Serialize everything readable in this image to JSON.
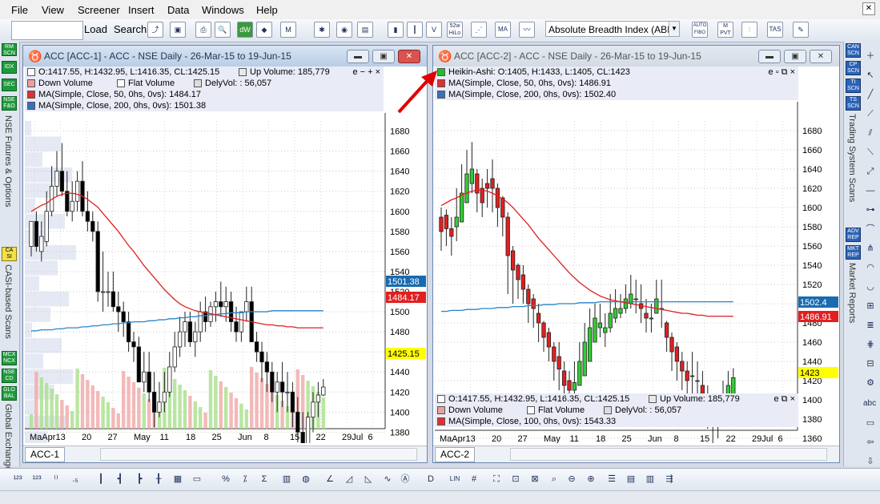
{
  "menu": [
    "File",
    "View",
    "Screener",
    "Insert",
    "Data",
    "Windows",
    "Help"
  ],
  "toolbar": {
    "symbol_value": "",
    "load_label": "Load",
    "search_label": "Search",
    "indicator_select": "Absolute Breadth Index (ABI",
    "icon_52w": "52w\nHiLo",
    "icon_ma": "MA",
    "icon_autofibo": "AUTO\nFIBO",
    "icon_pvt": "M\nPVT",
    "icon_tas": "TAS"
  },
  "left_sidebar": {
    "buttons": [
      "RM\nSCN",
      "IDX",
      "SEC",
      "NSE\nF&O",
      "CA\nSI",
      "MCX\nNCX",
      "NSE\nCD",
      "GLO\nBAL"
    ],
    "labels": [
      "NSE Futures & Options",
      "CASI-based Scans",
      "Global Exchange"
    ]
  },
  "right_sidebar": {
    "buttons": [
      "CAN\nSCN",
      "CP\nSCN",
      "TI\nSCN",
      "TS\nSCN",
      "ADV\nREP",
      "MKT\nREP"
    ],
    "labels": [
      "Trading System Scans",
      "Market Reports"
    ],
    "abc_label": "abc"
  },
  "charts": [
    {
      "title": "ACC [ACC-1] - ACC - NSE Daily - 26-Mar-15 to 19-Jun-15",
      "tab": "ACC-1",
      "legend": [
        {
          "c1": "O:1417.55, H:1432.95, L:1416.35, CL:1425.15",
          "c2": "Up Volume: 185,779",
          "color": "#e8e8e8"
        },
        {
          "c1": "Down Volume",
          "c2": "Flat Volume",
          "c3": "DelyVol: : 56,057",
          "color": "#e8a0a0"
        },
        {
          "c1": "MA(Simple, Close, 50, 0hs, 0vs): 1484.17",
          "color": "#e03030"
        },
        {
          "c1": "MA(Simple, Close, 200, 0hs, 0vs): 1501.38",
          "color": "#3a6fc0"
        }
      ],
      "legend_ctrl": "e − + ×",
      "y_ticks": [
        "1680",
        "1660",
        "1640",
        "1620",
        "1600",
        "1580",
        "1560",
        "1540",
        "1520",
        "1500",
        "1480",
        "1460",
        "1440",
        "1420",
        "1400",
        "1380",
        "1360"
      ],
      "x_ticks": [
        "MaApr",
        "13",
        "20",
        "27",
        "May",
        "11",
        "18",
        "25",
        "Jun",
        "8",
        "15",
        "22",
        "29Jul",
        "6"
      ],
      "tags": [
        {
          "text": "1501.38",
          "bg": "#1a6ab0",
          "fg": "#ffffff"
        },
        {
          "text": "1484.17",
          "bg": "#e02020",
          "fg": "#ffffff"
        },
        {
          "text": "1425.15",
          "bg": "#ffff00",
          "fg": "#000000"
        }
      ]
    },
    {
      "title": "ACC [ACC-2] - ACC - NSE Daily - 26-Mar-15 to 19-Jun-15",
      "tab": "ACC-2",
      "legend": [
        {
          "c1": "Heikin-Ashi: O:1405, H:1433, L:1405, CL:1423",
          "color": "#20c020"
        },
        {
          "c1": "MA(Simple, Close, 50, 0hs, 0vs): 1486.91",
          "color": "#e03030"
        },
        {
          "c1": "MA(Simple, Close, 200, 0hs, 0vs): 1502.40",
          "color": "#3a6fc0"
        }
      ],
      "legend_ctrl": "e ▫ ⧉ ×",
      "vol_legend": [
        {
          "c1": "O:1417.55, H:1432.95, L:1416.35, CL:1425.15",
          "c2": "Up Volume: 185,779",
          "color": "#e8e8e8"
        },
        {
          "c1": "Down Volume",
          "c2": "Flat Volume",
          "c3": "DelyVol: : 56,057",
          "color": "#e8a0a0"
        },
        {
          "c1": "MA(Simple, Close, 100, 0hs, 0vs): 1543.33",
          "color": "#e03030"
        }
      ],
      "vol_legend_ctrl": "e ⧉ ×",
      "y_ticks": [
        "1680",
        "1660",
        "1640",
        "1620",
        "1600",
        "1580",
        "1560",
        "1540",
        "1520",
        "1500",
        "1480",
        "1460",
        "1440",
        "1420",
        "1400",
        "1380",
        "1360"
      ],
      "x_ticks": [
        "MaApr",
        "13",
        "20",
        "27",
        "May",
        "11",
        "18",
        "25",
        "Jun",
        "8",
        "15",
        "22",
        "29Jul",
        "6"
      ],
      "tags": [
        {
          "text": "1502.4",
          "bg": "#1a6ab0",
          "fg": "#ffffff"
        },
        {
          "text": "1486.91",
          "bg": "#e02020",
          "fg": "#ffffff"
        },
        {
          "text": "1423",
          "bg": "#ffff00",
          "fg": "#000000"
        },
        {
          "text": "1425.15",
          "bg": "#ffff00",
          "fg": "#000000"
        }
      ]
    }
  ],
  "chart_data": [
    {
      "type": "candlestick",
      "title": "ACC - NSE Daily - 26-Mar-15 to 19-Jun-15",
      "ylim": [
        1350,
        1690
      ],
      "x": [
        "26-Mar",
        "27-Mar",
        "30-Mar",
        "31-Mar",
        "1-Apr",
        "6-Apr",
        "7-Apr",
        "8-Apr",
        "9-Apr",
        "10-Apr",
        "13-Apr",
        "15-Apr",
        "16-Apr",
        "17-Apr",
        "20-Apr",
        "21-Apr",
        "22-Apr",
        "23-Apr",
        "24-Apr",
        "27-Apr",
        "28-Apr",
        "29-Apr",
        "30-Apr",
        "4-May",
        "5-May",
        "6-May",
        "7-May",
        "8-May",
        "11-May",
        "12-May",
        "13-May",
        "14-May",
        "15-May",
        "18-May",
        "19-May",
        "20-May",
        "21-May",
        "22-May",
        "25-May",
        "26-May",
        "27-May",
        "28-May",
        "29-May",
        "1-Jun",
        "2-Jun",
        "3-Jun",
        "4-Jun",
        "5-Jun",
        "8-Jun",
        "9-Jun",
        "10-Jun",
        "11-Jun",
        "12-Jun",
        "15-Jun",
        "16-Jun",
        "17-Jun",
        "18-Jun",
        "19-Jun"
      ],
      "open": [
        1565,
        1590,
        1560,
        1570,
        1600,
        1625,
        1640,
        1620,
        1600,
        1610,
        1630,
        1600,
        1590,
        1580,
        1520,
        1520,
        1520,
        1505,
        1500,
        1490,
        1470,
        1465,
        1430,
        1440,
        1420,
        1400,
        1410,
        1420,
        1445,
        1465,
        1480,
        1490,
        1470,
        1480,
        1500,
        1490,
        1505,
        1510,
        1505,
        1510,
        1490,
        1480,
        1500,
        1510,
        1470,
        1460,
        1450,
        1440,
        1420,
        1430,
        1420,
        1420,
        1400,
        1380,
        1365,
        1395,
        1410,
        1417
      ],
      "high": [
        1590,
        1600,
        1590,
        1620,
        1645,
        1660,
        1668,
        1640,
        1630,
        1640,
        1650,
        1620,
        1600,
        1590,
        1560,
        1540,
        1540,
        1520,
        1510,
        1500,
        1480,
        1475,
        1460,
        1460,
        1440,
        1430,
        1440,
        1460,
        1480,
        1495,
        1500,
        1500,
        1490,
        1510,
        1515,
        1510,
        1520,
        1530,
        1525,
        1520,
        1505,
        1500,
        1525,
        1525,
        1480,
        1470,
        1460,
        1450,
        1440,
        1450,
        1440,
        1430,
        1415,
        1400,
        1400,
        1420,
        1430,
        1433
      ],
      "low": [
        1555,
        1560,
        1550,
        1565,
        1595,
        1615,
        1615,
        1595,
        1590,
        1600,
        1595,
        1580,
        1570,
        1510,
        1500,
        1505,
        1500,
        1480,
        1475,
        1460,
        1450,
        1440,
        1420,
        1410,
        1385,
        1395,
        1400,
        1415,
        1440,
        1455,
        1465,
        1465,
        1455,
        1470,
        1480,
        1485,
        1490,
        1495,
        1490,
        1480,
        1470,
        1470,
        1490,
        1475,
        1450,
        1430,
        1420,
        1410,
        1400,
        1405,
        1400,
        1385,
        1370,
        1355,
        1360,
        1380,
        1395,
        1416
      ],
      "close": [
        1590,
        1565,
        1575,
        1600,
        1625,
        1640,
        1620,
        1600,
        1610,
        1630,
        1600,
        1590,
        1580,
        1520,
        1520,
        1520,
        1505,
        1500,
        1490,
        1470,
        1465,
        1430,
        1440,
        1420,
        1400,
        1410,
        1420,
        1445,
        1465,
        1480,
        1490,
        1470,
        1480,
        1500,
        1490,
        1505,
        1510,
        1505,
        1510,
        1490,
        1480,
        1500,
        1510,
        1470,
        1460,
        1450,
        1440,
        1420,
        1430,
        1420,
        1420,
        1400,
        1380,
        1365,
        1395,
        1410,
        1417,
        1425
      ],
      "ma50": [
        1600,
        1603,
        1606,
        1608,
        1612,
        1615,
        1617,
        1618,
        1618,
        1617,
        1615,
        1612,
        1608,
        1604,
        1598,
        1592,
        1586,
        1580,
        1573,
        1566,
        1560,
        1553,
        1546,
        1540,
        1534,
        1528,
        1522,
        1517,
        1512,
        1508,
        1505,
        1503,
        1501,
        1500,
        1499,
        1498,
        1497,
        1496,
        1495,
        1494,
        1493,
        1492,
        1491,
        1490,
        1489,
        1488,
        1487,
        1487,
        1486,
        1486,
        1485,
        1485,
        1484,
        1484,
        1484,
        1484,
        1484,
        1484
      ],
      "ma200": [
        1481,
        1481,
        1482,
        1482,
        1482,
        1483,
        1483,
        1484,
        1484,
        1484,
        1485,
        1485,
        1486,
        1486,
        1487,
        1487,
        1488,
        1488,
        1489,
        1489,
        1490,
        1490,
        1490,
        1491,
        1491,
        1492,
        1492,
        1493,
        1493,
        1494,
        1494,
        1495,
        1495,
        1496,
        1496,
        1497,
        1497,
        1498,
        1498,
        1499,
        1499,
        1499,
        1500,
        1500,
        1500,
        1500,
        1500,
        1501,
        1501,
        1501,
        1501,
        1501,
        1501,
        1501,
        1501,
        1501,
        1501,
        1501
      ]
    },
    {
      "type": "heikin-ashi",
      "title": "ACC - NSE Daily - 26-Mar-15 to 19-Jun-15",
      "ylim": [
        1350,
        1690
      ],
      "x": [
        "26-Mar",
        "27-Mar",
        "30-Mar",
        "31-Mar",
        "1-Apr",
        "6-Apr",
        "7-Apr",
        "8-Apr",
        "9-Apr",
        "10-Apr",
        "13-Apr",
        "15-Apr",
        "16-Apr",
        "17-Apr",
        "20-Apr",
        "21-Apr",
        "22-Apr",
        "23-Apr",
        "24-Apr",
        "27-Apr",
        "28-Apr",
        "29-Apr",
        "30-Apr",
        "4-May",
        "5-May",
        "6-May",
        "7-May",
        "8-May",
        "11-May",
        "12-May",
        "13-May",
        "14-May",
        "15-May",
        "18-May",
        "19-May",
        "20-May",
        "21-May",
        "22-May",
        "25-May",
        "26-May",
        "27-May",
        "28-May",
        "29-May",
        "1-Jun",
        "2-Jun",
        "3-Jun",
        "4-Jun",
        "5-Jun",
        "8-Jun",
        "9-Jun",
        "10-Jun",
        "11-Jun",
        "12-Jun",
        "15-Jun",
        "16-Jun",
        "17-Jun",
        "18-Jun",
        "19-Jun"
      ],
      "open": [
        1590,
        1592,
        1578,
        1580,
        1585,
        1605,
        1625,
        1635,
        1620,
        1625,
        1630,
        1620,
        1610,
        1590,
        1555,
        1540,
        1530,
        1515,
        1505,
        1490,
        1480,
        1470,
        1455,
        1445,
        1430,
        1420,
        1410,
        1415,
        1425,
        1440,
        1460,
        1475,
        1470,
        1475,
        1485,
        1490,
        1495,
        1500,
        1505,
        1500,
        1490,
        1485,
        1490,
        1495,
        1480,
        1465,
        1455,
        1440,
        1430,
        1425,
        1420,
        1415,
        1400,
        1385,
        1375,
        1385,
        1395,
        1405
      ],
      "high": [
        1600,
        1598,
        1590,
        1620,
        1645,
        1660,
        1668,
        1640,
        1630,
        1640,
        1650,
        1625,
        1612,
        1595,
        1560,
        1542,
        1540,
        1520,
        1510,
        1500,
        1482,
        1475,
        1460,
        1460,
        1440,
        1430,
        1440,
        1460,
        1480,
        1495,
        1500,
        1500,
        1490,
        1510,
        1515,
        1510,
        1520,
        1530,
        1525,
        1520,
        1505,
        1500,
        1525,
        1525,
        1482,
        1470,
        1460,
        1450,
        1440,
        1450,
        1440,
        1430,
        1415,
        1400,
        1400,
        1420,
        1430,
        1433
      ],
      "low": [
        1555,
        1560,
        1550,
        1565,
        1585,
        1605,
        1615,
        1595,
        1590,
        1600,
        1595,
        1580,
        1570,
        1510,
        1500,
        1505,
        1500,
        1480,
        1475,
        1460,
        1450,
        1440,
        1420,
        1410,
        1385,
        1395,
        1400,
        1415,
        1425,
        1440,
        1460,
        1465,
        1455,
        1470,
        1480,
        1485,
        1490,
        1495,
        1490,
        1480,
        1470,
        1470,
        1490,
        1475,
        1450,
        1430,
        1420,
        1410,
        1400,
        1405,
        1400,
        1385,
        1370,
        1355,
        1360,
        1380,
        1395,
        1405
      ],
      "close": [
        1575,
        1578,
        1570,
        1590,
        1615,
        1635,
        1640,
        1615,
        1605,
        1620,
        1620,
        1600,
        1590,
        1550,
        1535,
        1525,
        1515,
        1500,
        1495,
        1480,
        1465,
        1455,
        1440,
        1432,
        1415,
        1410,
        1418,
        1440,
        1460,
        1475,
        1485,
        1480,
        1475,
        1490,
        1495,
        1495,
        1505,
        1510,
        1505,
        1495,
        1485,
        1485,
        1505,
        1495,
        1465,
        1450,
        1440,
        1430,
        1420,
        1425,
        1420,
        1405,
        1390,
        1375,
        1380,
        1400,
        1415,
        1423
      ],
      "ma50": [
        1602,
        1605,
        1608,
        1610,
        1613,
        1615,
        1617,
        1618,
        1618,
        1617,
        1615,
        1612,
        1609,
        1605,
        1600,
        1594,
        1588,
        1582,
        1575,
        1568,
        1562,
        1556,
        1550,
        1544,
        1538,
        1532,
        1527,
        1522,
        1518,
        1514,
        1511,
        1508,
        1506,
        1504,
        1503,
        1502,
        1501,
        1500,
        1499,
        1498,
        1497,
        1496,
        1495,
        1494,
        1493,
        1492,
        1491,
        1490,
        1490,
        1489,
        1488,
        1488,
        1487,
        1487,
        1487,
        1487,
        1487,
        1487
      ],
      "ma200": [
        1492,
        1492,
        1493,
        1493,
        1493,
        1494,
        1494,
        1494,
        1495,
        1495,
        1495,
        1496,
        1496,
        1496,
        1497,
        1497,
        1497,
        1498,
        1498,
        1498,
        1499,
        1499,
        1499,
        1500,
        1500,
        1500,
        1500,
        1501,
        1501,
        1501,
        1501,
        1502,
        1502,
        1502,
        1502,
        1502,
        1502,
        1502,
        1502,
        1502,
        1502,
        1502,
        1502,
        1502,
        1502,
        1502,
        1502,
        1502,
        1502,
        1502,
        1502,
        1502,
        1502,
        1502,
        1502,
        1502,
        1502,
        1502
      ]
    }
  ],
  "status": ""
}
